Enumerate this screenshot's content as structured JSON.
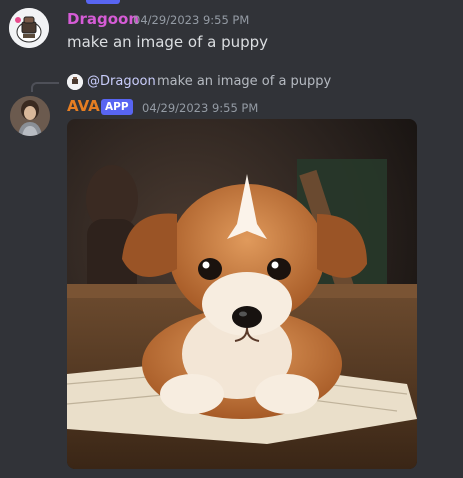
{
  "messages": [
    {
      "author": "Dragoon",
      "timestamp": "04/29/2023 9:55 PM",
      "content": "make an image of a puppy",
      "author_color": "#d65cd6"
    },
    {
      "author": "AVA",
      "badge": "APP",
      "timestamp": "04/29/2023 9:55 PM",
      "author_color": "#e67e22",
      "reply": {
        "mention": "@Dragoon",
        "text": "make an image of a puppy"
      },
      "attachment": {
        "icon": "puppy-image"
      }
    }
  ],
  "colors": {
    "background": "#313338",
    "badge": "#5865f2",
    "mention": "#c9cdfb"
  }
}
